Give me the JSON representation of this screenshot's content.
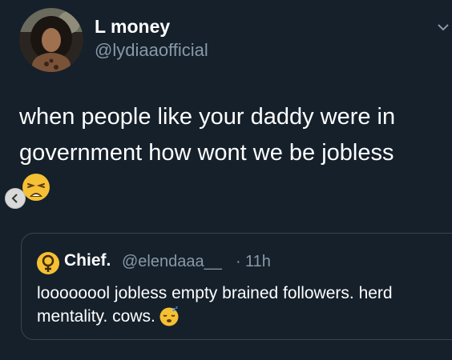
{
  "author": {
    "display_name": "L money",
    "handle": "@lydiaaofficial"
  },
  "tweet": {
    "text": "when people like your daddy were in government how wont we be jobless",
    "emoji": "weary-face-emoji"
  },
  "quoted_tweet": {
    "display_name": "Chief.",
    "handle": "@elendaaa__",
    "separator": "·",
    "time": "11h",
    "text": "loooooool jobless empty brained followers. herd mentality. cows.",
    "emoji": "sleeping-face-emoji"
  },
  "icons": {
    "more": "chevron-down-icon",
    "back": "chevron-left-icon",
    "emblem": "female-sign-emblem-icon"
  },
  "colors": {
    "background": "#15202b",
    "secondary_text": "#8899a6",
    "card_border": "#38444d"
  }
}
